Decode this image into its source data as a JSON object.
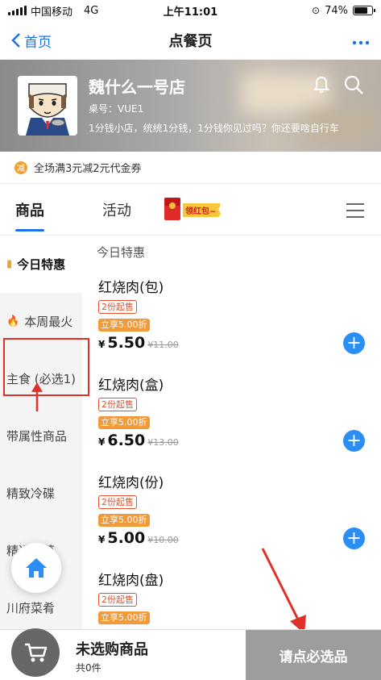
{
  "status_bar": {
    "carrier": "中国移动",
    "network": "4G",
    "time": "上午11:01",
    "battery": "74%"
  },
  "nav": {
    "back_label": "首页",
    "title": "点餐页"
  },
  "shop": {
    "name": "魏什么一号店",
    "table": "桌号：VUE1",
    "description": "1分钱小店，统统1分钱，1分钱你见过吗？你还要啥自行车"
  },
  "promo": {
    "badge": "减",
    "text": "全场满3元减2元代金券"
  },
  "tabs": [
    {
      "label": "商品"
    },
    {
      "label": "活动"
    }
  ],
  "redpacket_label": "领红包~",
  "categories": [
    {
      "label": "今日特惠"
    },
    {
      "label": "本周最火"
    },
    {
      "label": "主食 (必选1)"
    },
    {
      "label": "带属性商品"
    },
    {
      "label": "精致冷碟"
    },
    {
      "label": "精选热菜"
    },
    {
      "label": "川府菜肴"
    }
  ],
  "section_title": "今日特惠",
  "products": [
    {
      "name": "红烧肉(包)",
      "min": "2份起售",
      "discount": "立享5.00折",
      "currency": "¥",
      "price": "5.50",
      "original": "¥11.00"
    },
    {
      "name": "红烧肉(盒)",
      "min": "2份起售",
      "discount": "立享5.00折",
      "currency": "¥",
      "price": "6.50",
      "original": "¥13.00"
    },
    {
      "name": "红烧肉(份)",
      "min": "2份起售",
      "discount": "立享5.00折",
      "currency": "¥",
      "price": "5.00",
      "original": "¥10.00"
    },
    {
      "name": "红烧肉(盘)",
      "min": "2份起售",
      "discount": "立享5.00折",
      "currency": "¥",
      "price": "",
      "original": ""
    }
  ],
  "cart": {
    "title": "未选购商品",
    "count": "共0件"
  },
  "checkout_label": "请点必选品",
  "colors": {
    "accent": "#1a73e8",
    "add": "#2a8ef2",
    "annotation": "#e0302a",
    "discount": "#f29a3a"
  }
}
